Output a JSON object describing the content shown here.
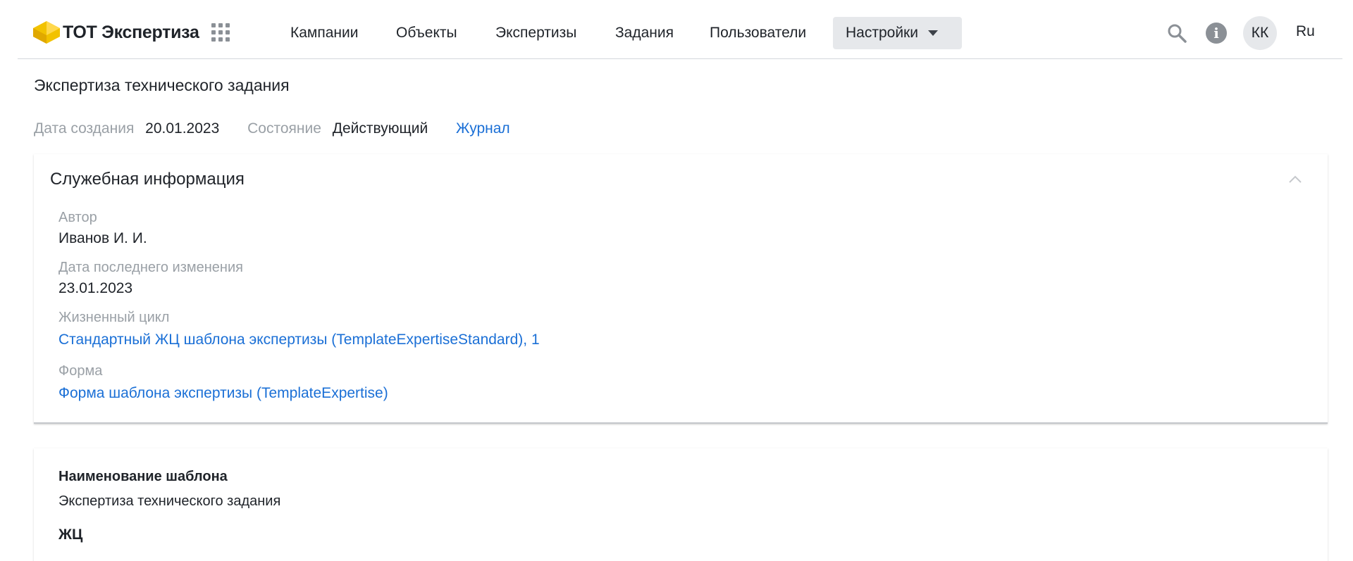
{
  "header": {
    "logo_text": "ТОТ Экспертиза",
    "brand_color": "#f2c200",
    "nav": [
      {
        "label": "Кампании"
      },
      {
        "label": "Объекты"
      },
      {
        "label": "Экспертизы"
      },
      {
        "label": "Задания"
      },
      {
        "label": "Пользователи"
      },
      {
        "label": "Настройки"
      }
    ],
    "active_nav": "Настройки",
    "avatar_initials": "КК",
    "language": "Ru",
    "icons": [
      "apps-grid-icon",
      "search-icon",
      "info-icon",
      "chevron-down-icon"
    ]
  },
  "page": {
    "title": "Экспертиза технического задания",
    "meta": {
      "created_label": "Дата создания",
      "created_value": "20.01.2023",
      "state_label": "Состояние",
      "state_value": "Действующий",
      "journal_link": "Журнал"
    }
  },
  "service_info": {
    "title": "Служебная информация",
    "author_label": "Автор",
    "author_value": "Иванов И. И.",
    "modified_label": "Дата последнего изменения",
    "modified_value": "23.01.2023",
    "lifecycle_label": "Жизненный цикл",
    "lifecycle_value": "Стандартный ЖЦ шаблона экспертизы (TemplateExpertiseStandard), 1",
    "form_label": "Форма",
    "form_value": "Форма шаблона экспертизы (TemplateExpertise)"
  },
  "template": {
    "name_label": "Наименование шаблона",
    "name_value": "Экспертиза технического задания",
    "lc_label": "ЖЦ"
  },
  "colors": {
    "link": "#1a6fd6",
    "muted": "#9aa0a6",
    "text": "#1f2329"
  }
}
